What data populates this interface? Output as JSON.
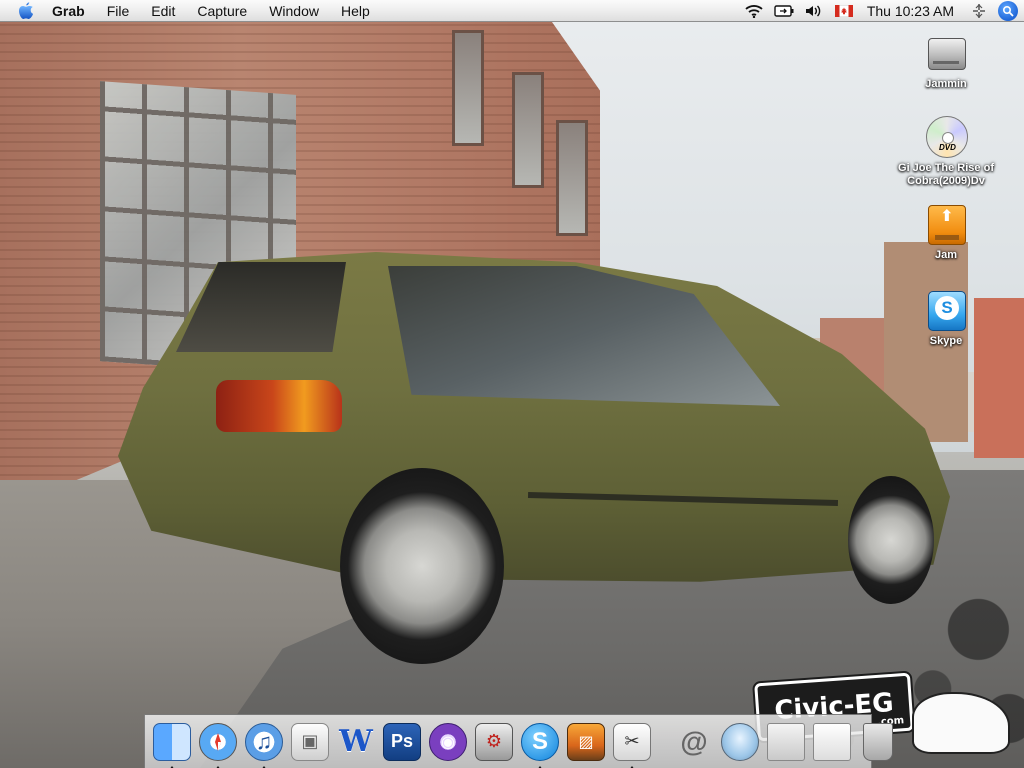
{
  "menubar": {
    "apple_icon": "apple-icon",
    "app_name": "Grab",
    "menus": [
      "File",
      "Edit",
      "Capture",
      "Window",
      "Help"
    ],
    "status": {
      "clock": "Thu 10:23 AM",
      "icons": [
        "wifi-icon",
        "battery-icon",
        "volume-icon",
        "canada-flag-icon",
        "bluetooth-icon",
        "spotlight-icon"
      ]
    }
  },
  "desktop": {
    "icons": [
      {
        "label": "Jammin",
        "icon": "hard-drive-icon"
      },
      {
        "label": "Gi Joe The Rise of Cobra(2009)Dv",
        "icon": "dvd-disc-icon",
        "badge": "DVD"
      },
      {
        "label": "Jam",
        "icon": "usb-drive-icon"
      },
      {
        "label": "Skype",
        "icon": "skype-icon"
      }
    ]
  },
  "wallpaper": {
    "watermark": "Civic-EG",
    "watermark_suffix": ".com"
  },
  "dock": {
    "apps": [
      {
        "icon": "finder-icon",
        "running": true
      },
      {
        "icon": "safari-icon",
        "running": true
      },
      {
        "icon": "itunes-icon",
        "running": true
      },
      {
        "icon": "boot-camp-icon",
        "running": false
      },
      {
        "icon": "word-icon",
        "running": false,
        "glyph": "W"
      },
      {
        "icon": "photoshop-icon",
        "running": false,
        "glyph": "Ps"
      },
      {
        "icon": "itunes-purple-icon",
        "running": false
      },
      {
        "icon": "preferences-icon",
        "running": false
      },
      {
        "icon": "skype-dock-icon",
        "running": true,
        "glyph": "S"
      },
      {
        "icon": "iphoto-icon",
        "running": false
      },
      {
        "icon": "script-editor-icon",
        "running": true
      }
    ],
    "stacks": [
      {
        "icon": "mail-icon",
        "glyph": "@"
      },
      {
        "icon": "disk-utility-icon"
      },
      {
        "icon": "documents-stack-icon"
      },
      {
        "icon": "downloads-stack-icon"
      },
      {
        "icon": "trash-icon"
      }
    ]
  }
}
